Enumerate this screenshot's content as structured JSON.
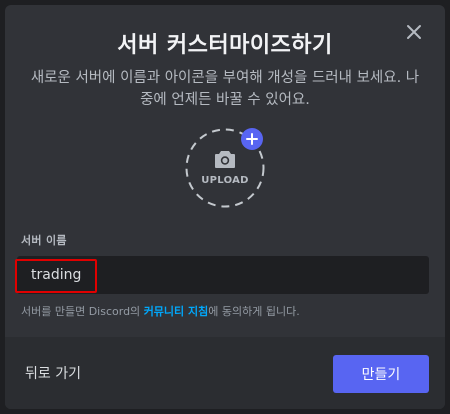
{
  "modal": {
    "title": "서버 커스터마이즈하기",
    "subtitle": "새로운 서버에 이름과 아이콘을 부여해 개성을 드러내 보세요. 나중에 언제든 바꿀 수 있어요.",
    "upload_label": "UPLOAD"
  },
  "server_name": {
    "label": "서버 이름",
    "value": "trading"
  },
  "note": {
    "prefix": "서버를 만들면 Discord의 ",
    "link": "커뮤니티 지침",
    "suffix": "에 동의하게 됩니다."
  },
  "footer": {
    "back_label": "뒤로 가기",
    "create_label": "만들기"
  },
  "colors": {
    "accent": "#5865f2",
    "link": "#00a8fc",
    "highlight": "#e00000"
  },
  "icons": [
    "close-icon",
    "camera-icon",
    "plus-icon"
  ]
}
